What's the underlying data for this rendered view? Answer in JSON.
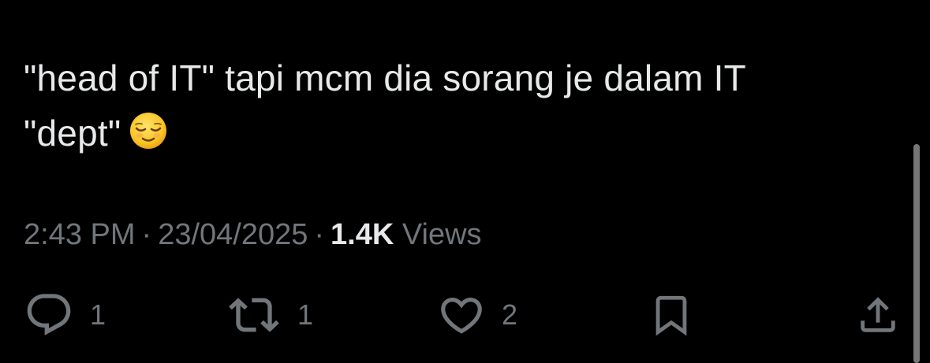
{
  "tweet": {
    "text_line1": "\"head of IT\" tapi mcm dia sorang je dalam IT",
    "text_line2": "\"dept\"",
    "emoji": "relieved-face"
  },
  "meta": {
    "time": "2:43 PM",
    "separator": "·",
    "date": "23/04/2025",
    "views_count": "1.4K",
    "views_label": "Views"
  },
  "actions": {
    "replies": "1",
    "reposts": "1",
    "likes": "2"
  },
  "colors": {
    "background": "#000000",
    "text": "#e7e9ea",
    "muted": "#71767b"
  }
}
